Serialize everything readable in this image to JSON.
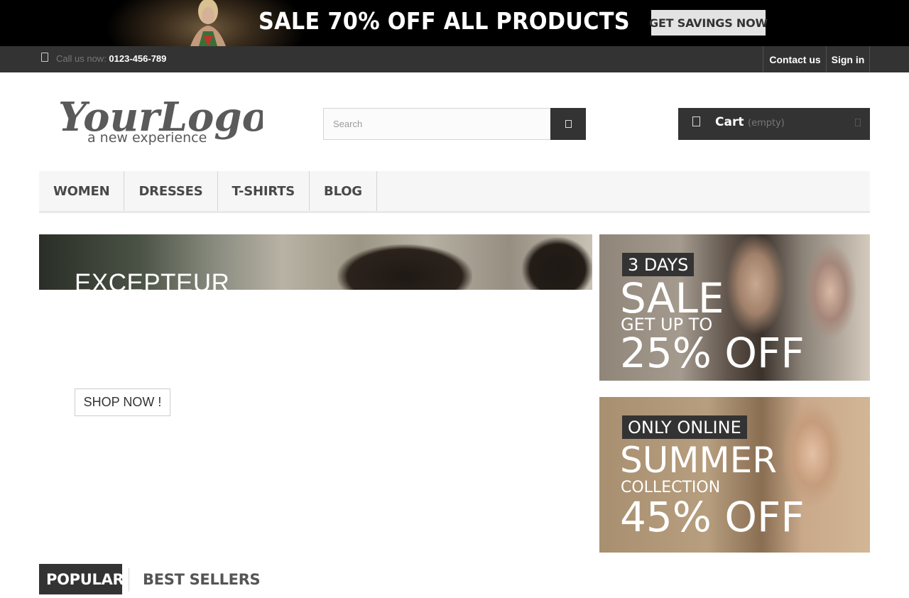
{
  "promo": {
    "text": "SALE 70% OFF ALL PRODUCTS",
    "button_label": "GET SAVINGS NOW"
  },
  "topbar": {
    "call_prefix": "Call us now: ",
    "phone": "0123-456-789",
    "contact_label": "Contact us",
    "signin_label": "Sign in"
  },
  "header": {
    "logo_main": "YourLogo",
    "logo_tagline": "a new experience",
    "search_placeholder": "Search",
    "cart_label": "Cart",
    "cart_status": "(empty)"
  },
  "menu": {
    "items": [
      "WOMEN",
      "DRESSES",
      "T-SHIRTS",
      "BLOG"
    ]
  },
  "slider": {
    "title": "EXCEPTEUR",
    "button_label": "SHOP NOW !"
  },
  "banners": [
    {
      "tag": "3 DAYS",
      "headline": "SALE",
      "subline": "GET UP TO",
      "offer": "25% OFF"
    },
    {
      "tag": "ONLY ONLINE",
      "headline": "SUMMER",
      "subline": "COLLECTION",
      "offer": "45% OFF"
    }
  ],
  "tabs": {
    "popular": "POPULAR",
    "best_sellers": "BEST SELLERS"
  },
  "colors": {
    "dark": "#333333",
    "promo_bg": "#000000",
    "menu_bg": "#f6f6f6"
  },
  "icons": [
    "phone-icon",
    "search-icon",
    "cart-icon",
    "cart-dropdown-icon"
  ]
}
